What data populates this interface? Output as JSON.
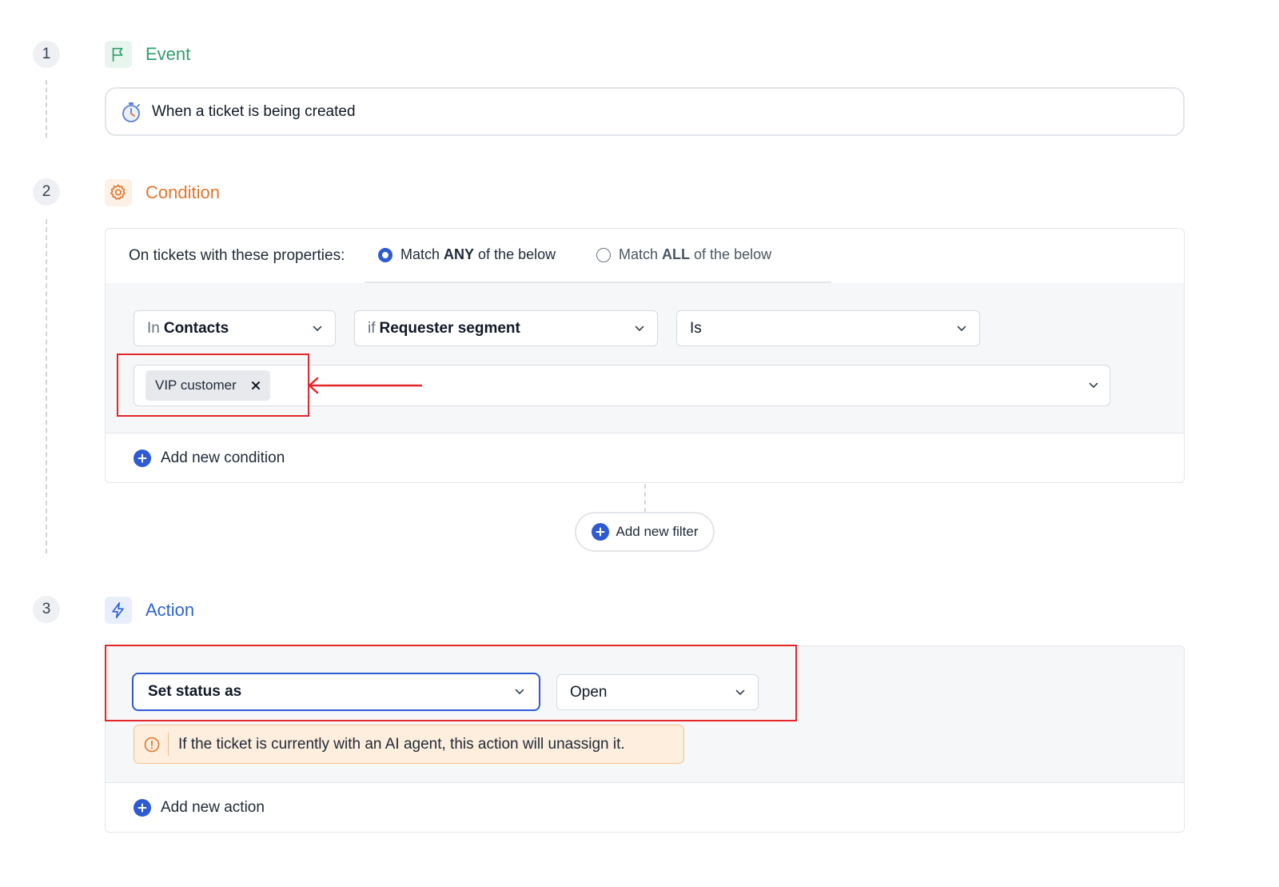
{
  "steps": [
    {
      "number": "1",
      "title": "Event",
      "color": "#2e9e6b"
    },
    {
      "number": "2",
      "title": "Condition",
      "color": "#e0772e"
    },
    {
      "number": "3",
      "title": "Action",
      "color": "#2f63d4"
    }
  ],
  "event": {
    "icon": "stopwatch-icon",
    "text": "When a ticket is being created"
  },
  "condition": {
    "intro": "On tickets with these properties:",
    "match_any": {
      "prefix": "Match ",
      "strong": "ANY",
      "suffix": " of the below",
      "selected": true
    },
    "match_all": {
      "prefix": "Match ",
      "strong": "ALL",
      "suffix": " of the below",
      "selected": false
    },
    "in_select": {
      "prefix": "In",
      "value": "Contacts"
    },
    "if_select": {
      "prefix": "if",
      "value": "Requester segment"
    },
    "op_select": {
      "value": "Is"
    },
    "tag": {
      "label": "VIP customer"
    },
    "add_condition": "Add new condition",
    "add_filter": "Add new filter"
  },
  "action": {
    "type_select": {
      "value": "Set status as"
    },
    "status_select": {
      "value": "Open"
    },
    "warning": "If the ticket is currently with an AI agent, this action will unassign it.",
    "add_action": "Add new action"
  },
  "colors": {
    "accent_blue": "#2e5bd3",
    "highlight_red": "#e5262a",
    "warning_bg": "#fdeedd",
    "warning_border": "#f3c48c"
  }
}
